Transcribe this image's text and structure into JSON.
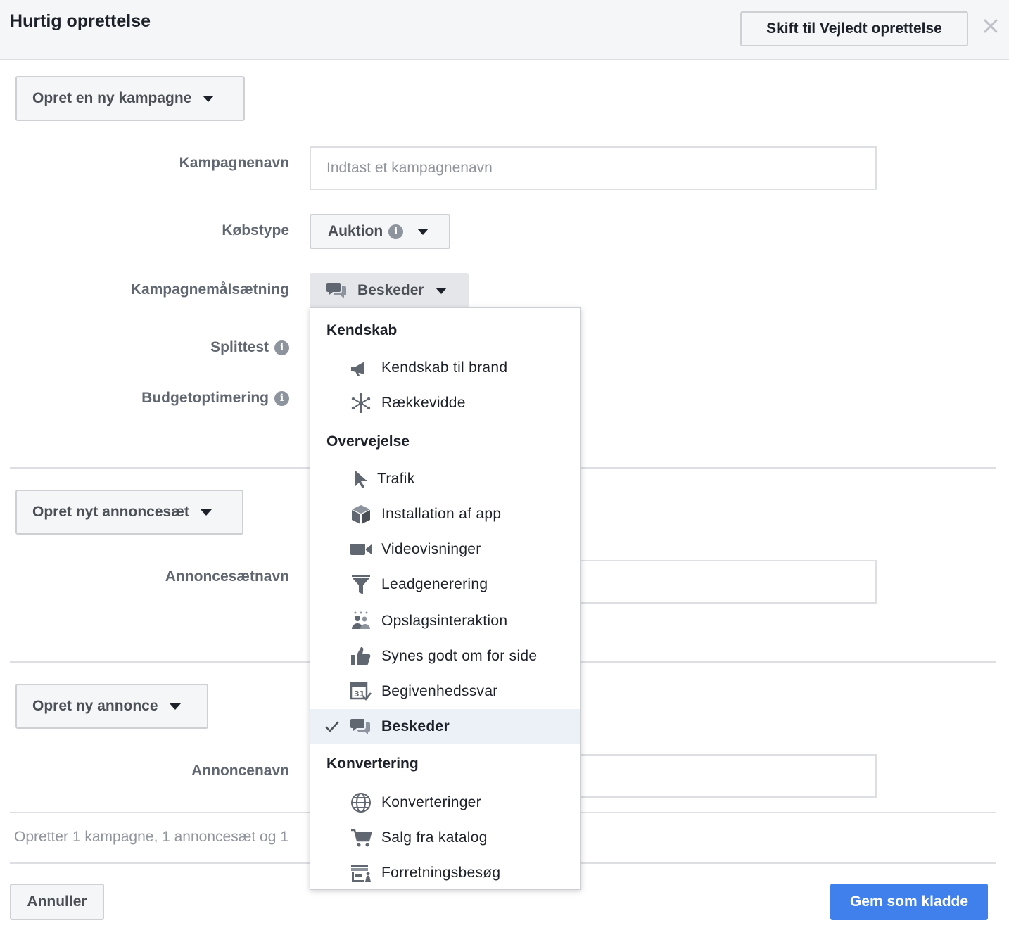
{
  "header": {
    "title": "Hurtig oprettelse",
    "switch_label": "Skift til Vejledt oprettelse"
  },
  "campaign": {
    "create_label": "Opret en ny kampagne",
    "name_label": "Kampagnenavn",
    "name_placeholder": "Indtast et kampagnenavn",
    "buy_type_label": "Købstype",
    "buy_type_value": "Auktion",
    "objective_label": "Kampagnemålsætning",
    "objective_value": "Beskeder",
    "split_test_label": "Splittest",
    "budget_opt_label": "Budgetoptimering"
  },
  "adset": {
    "create_label": "Opret nyt annoncesæt",
    "name_label": "Annoncesætnavn"
  },
  "ad": {
    "create_label": "Opret ny annonce",
    "name_label": "Annoncenavn"
  },
  "summary_text": "Opretter 1 kampagne, 1 annoncesæt og 1",
  "footer": {
    "cancel_label": "Annuller",
    "save_label": "Gem som kladde"
  },
  "dropdown": {
    "groups": [
      {
        "title": "Kendskab",
        "items": [
          {
            "label": "Kendskab til brand",
            "icon": "megaphone-icon"
          },
          {
            "label": "Rækkevidde",
            "icon": "reach-icon"
          }
        ]
      },
      {
        "title": "Overvejelse",
        "items": [
          {
            "label": "Trafik",
            "icon": "cursor-icon"
          },
          {
            "label": "Installation af app",
            "icon": "box-icon"
          },
          {
            "label": "Videovisninger",
            "icon": "video-camera-icon"
          },
          {
            "label": "Leadgenerering",
            "icon": "funnel-icon"
          },
          {
            "label": "Opslagsinteraktion",
            "icon": "people-icon"
          },
          {
            "label": "Synes godt om for side",
            "icon": "thumbs-up-icon"
          },
          {
            "label": "Begivenhedssvar",
            "icon": "calendar-icon"
          },
          {
            "label": "Beskeder",
            "icon": "chat-bubbles-icon",
            "selected": true
          }
        ]
      },
      {
        "title": "Konvertering",
        "items": [
          {
            "label": "Konverteringer",
            "icon": "globe-icon"
          },
          {
            "label": "Salg fra katalog",
            "icon": "cart-icon"
          },
          {
            "label": "Forretningsbesøg",
            "icon": "store-icon"
          }
        ]
      }
    ]
  }
}
